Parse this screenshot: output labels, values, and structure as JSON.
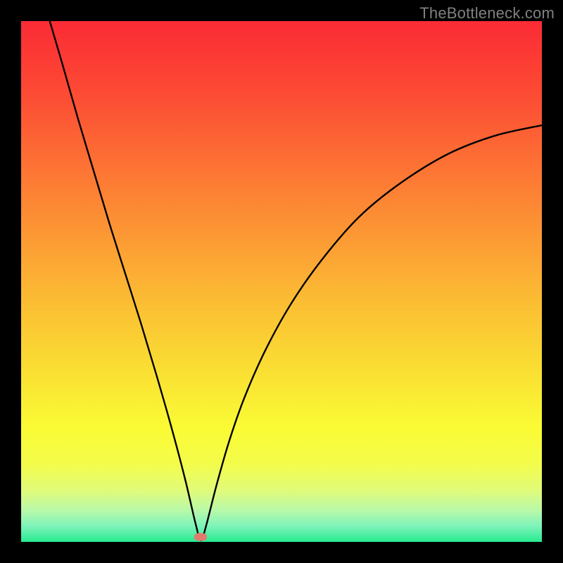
{
  "watermark": "TheBottleneck.com",
  "colors": {
    "frame": "#000000",
    "curve": "#000000",
    "marker": "#e17a6f",
    "gradient_stops": [
      {
        "offset": 0.0,
        "color": "#fb2b35"
      },
      {
        "offset": 0.14,
        "color": "#fc4b34"
      },
      {
        "offset": 0.28,
        "color": "#fd7334"
      },
      {
        "offset": 0.42,
        "color": "#fc9b34"
      },
      {
        "offset": 0.55,
        "color": "#fbc033"
      },
      {
        "offset": 0.68,
        "color": "#fae133"
      },
      {
        "offset": 0.78,
        "color": "#fafb34"
      },
      {
        "offset": 0.85,
        "color": "#f4fc4a"
      },
      {
        "offset": 0.9,
        "color": "#e1fb78"
      },
      {
        "offset": 0.94,
        "color": "#b8f9a9"
      },
      {
        "offset": 0.97,
        "color": "#7df3ba"
      },
      {
        "offset": 1.0,
        "color": "#27eb90"
      }
    ]
  },
  "chart_data": {
    "type": "line",
    "title": "",
    "xlabel": "",
    "ylabel": "",
    "xlim": [
      0,
      1
    ],
    "ylim": [
      0,
      1
    ],
    "notes": "V-shaped bottleneck curve. Minimum (optimal/green) near x≈0.345, y≈0. Left branch starts near top-left at (≈0.055, 1.0); right branch reaches (1.0, ≈0.80). Values are normalized to plot area; no axes or tick labels shown.",
    "series": [
      {
        "name": "bottleneck-curve",
        "points": [
          {
            "x": 0.055,
            "y": 1.0
          },
          {
            "x": 0.08,
            "y": 0.915
          },
          {
            "x": 0.11,
            "y": 0.81
          },
          {
            "x": 0.14,
            "y": 0.71
          },
          {
            "x": 0.17,
            "y": 0.61
          },
          {
            "x": 0.2,
            "y": 0.515
          },
          {
            "x": 0.23,
            "y": 0.42
          },
          {
            "x": 0.26,
            "y": 0.32
          },
          {
            "x": 0.29,
            "y": 0.215
          },
          {
            "x": 0.315,
            "y": 0.12
          },
          {
            "x": 0.335,
            "y": 0.035
          },
          {
            "x": 0.345,
            "y": 0.003
          },
          {
            "x": 0.355,
            "y": 0.03
          },
          {
            "x": 0.375,
            "y": 0.108
          },
          {
            "x": 0.4,
            "y": 0.195
          },
          {
            "x": 0.43,
            "y": 0.28
          },
          {
            "x": 0.47,
            "y": 0.37
          },
          {
            "x": 0.52,
            "y": 0.46
          },
          {
            "x": 0.58,
            "y": 0.545
          },
          {
            "x": 0.65,
            "y": 0.625
          },
          {
            "x": 0.73,
            "y": 0.69
          },
          {
            "x": 0.82,
            "y": 0.745
          },
          {
            "x": 0.91,
            "y": 0.78
          },
          {
            "x": 1.0,
            "y": 0.8
          }
        ]
      }
    ],
    "marker": {
      "x": 0.345,
      "y": 0.01
    }
  }
}
